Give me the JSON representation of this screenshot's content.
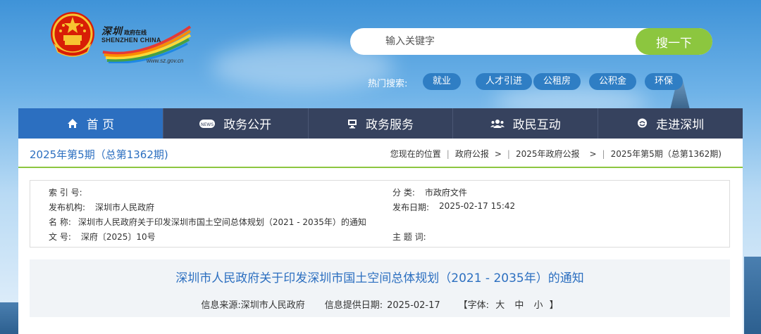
{
  "header": {
    "brand_cn": "深圳",
    "brand_cn_small": "政府在线",
    "brand_en": "SHENZHEN CHINA",
    "brand_url": "www.sz.gov.cn"
  },
  "search": {
    "placeholder": "输入关键字",
    "button_label": "搜一下"
  },
  "hot_search": {
    "label": "热门搜索:",
    "tags": [
      "就业",
      "人才引进",
      "公租房",
      "公积金",
      "环保"
    ]
  },
  "nav": {
    "items": [
      {
        "label": "首 页",
        "icon": "home-icon"
      },
      {
        "label": "政务公开",
        "icon": "news-icon"
      },
      {
        "label": "政务服务",
        "icon": "monitor-icon"
      },
      {
        "label": "政民互动",
        "icon": "people-icon"
      },
      {
        "label": "走进深圳",
        "icon": "chat-bubble-icon"
      }
    ]
  },
  "breadcrumb": {
    "issue_title": "2025年第5期（总第1362期)",
    "location_label": "您现在的位置",
    "path": [
      "政府公报",
      "2025年政府公报",
      "2025年第5期（总第1362期)"
    ]
  },
  "info": {
    "index_label": "索 引 号:",
    "index_value": "",
    "category_label": "分 类:",
    "category_value": "市政府文件",
    "publisher_label": "发布机构:",
    "publisher_value": "深圳市人民政府",
    "pubdate_label": "发布日期:",
    "pubdate_value": "2025-02-17 15:42",
    "name_label": "名 称:",
    "name_value": "深圳市人民政府关于印发深圳市国土空间总体规划（2021 - 2035年）的通知",
    "docno_label": "文 号:",
    "docno_value": "深府〔2025〕10号",
    "keywords_label": "主 题 词:",
    "keywords_value": ""
  },
  "article": {
    "title": "深圳市人民政府关于印发深圳市国土空间总体规划（2021 - 2035年）的通知",
    "source_label": "信息来源:",
    "source_value": "深圳市人民政府",
    "date_label": "信息提供日期:",
    "date_value": "2025-02-17",
    "font_label": "【字体:",
    "font_large": "大",
    "font_medium": "中",
    "font_small": "小",
    "font_close": "】"
  },
  "colors": {
    "nav_bg": "#36425e",
    "nav_active": "#2c6fc0",
    "accent_green": "#8cc63f",
    "link_blue": "#2c6fc0",
    "tag_blue": "#2f7ec4"
  }
}
